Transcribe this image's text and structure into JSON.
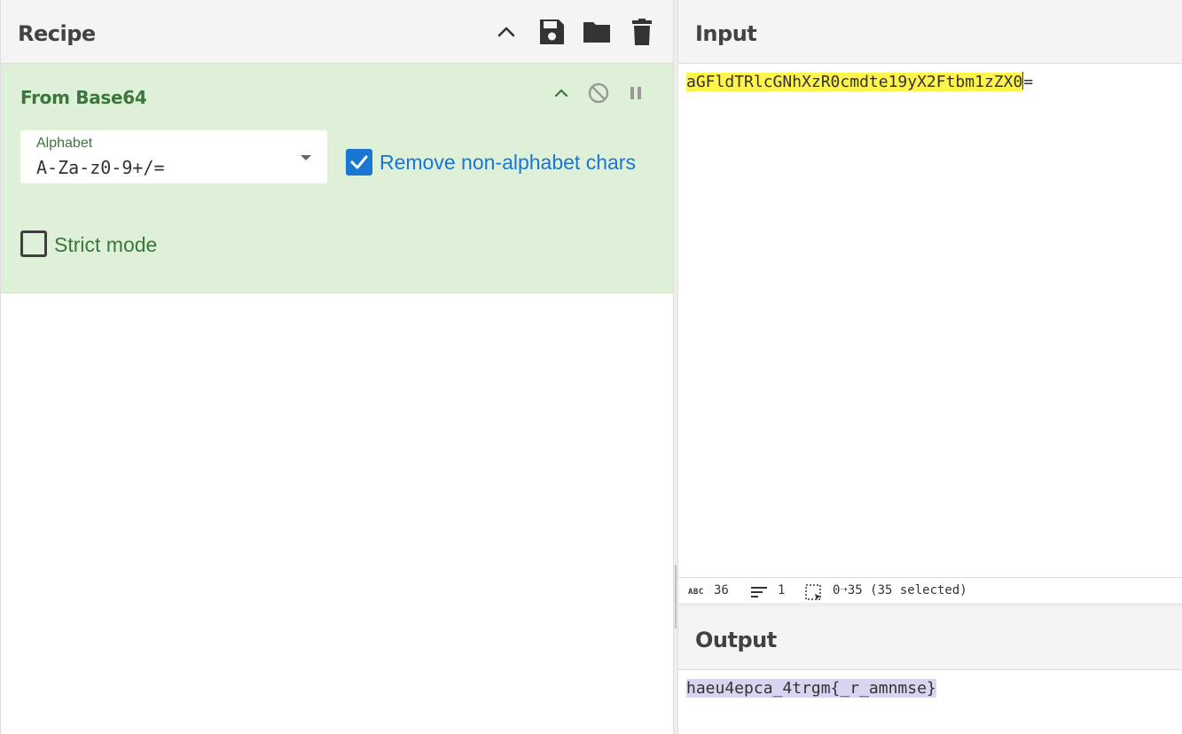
{
  "recipe": {
    "title": "Recipe",
    "header_icons": [
      "chevron-up-icon",
      "save-icon",
      "folder-icon",
      "trash-icon"
    ],
    "operation": {
      "title": "From Base64",
      "controls": [
        "chevron-up-icon",
        "disable-icon",
        "pause-icon"
      ],
      "alphabet": {
        "label": "Alphabet",
        "value": "A-Za-z0-9+/="
      },
      "remove_non_alphabet": {
        "label": "Remove non-alphabet chars",
        "checked": true
      },
      "strict_mode": {
        "label": "Strict mode",
        "checked": false
      }
    }
  },
  "input": {
    "title": "Input",
    "text_selected": "aGFldTRlcGNhXzR0cmdte19yX2Ftbm1zZX0",
    "text_rest": "=",
    "status": {
      "length_icon": "ABC",
      "length": "36",
      "lines": "1",
      "selection": "0➝35 (35 selected)"
    }
  },
  "output": {
    "title": "Output",
    "text": "haeu4epca_4trgm{_r_amnmse}"
  },
  "colors": {
    "op_background": "#dff0d8",
    "op_title": "#3c763d",
    "checkbox_accent": "#1976d2",
    "input_highlight": "#fff34d",
    "output_highlight": "#d9d4ef"
  }
}
